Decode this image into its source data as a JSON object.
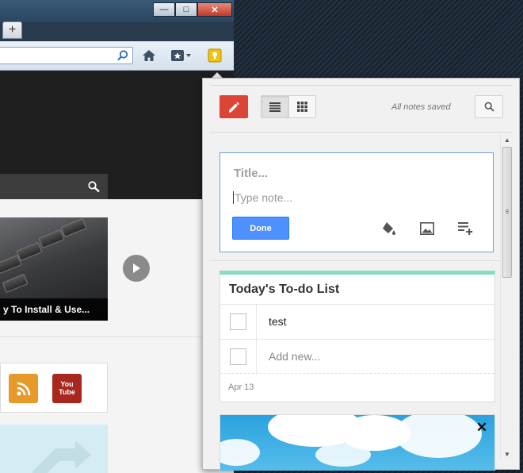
{
  "window": {
    "minimize_glyph": "—",
    "maximize_glyph": "□",
    "close_glyph": "✕",
    "new_tab_label": "+"
  },
  "browser_toolbar": {
    "url_value": "",
    "icons": [
      "search-icon",
      "home-icon",
      "bookmarks-icon",
      "keep-extension-icon"
    ]
  },
  "page": {
    "video_caption": "y To Install & Use...",
    "youtube_logo_text": "You Tube"
  },
  "keep": {
    "logo_icon": "pencil-icon",
    "view_modes": [
      "list-view-icon",
      "grid-view-icon"
    ],
    "status": "All notes saved",
    "composer": {
      "title_placeholder": "Title...",
      "body_placeholder": "Type note...",
      "done_label": "Done",
      "tools": [
        "paint-bucket-icon",
        "image-icon",
        "checklist-add-icon"
      ]
    },
    "todo": {
      "title": "Today's To-do List",
      "accent_color": "#86dcc0",
      "items": [
        {
          "text": "test",
          "checked": false
        }
      ],
      "add_placeholder": "Add new...",
      "date": "Apr 13"
    },
    "image_note": {
      "close_glyph": "✕"
    }
  },
  "colors": {
    "keep_red": "#db4437",
    "done_blue": "#4d90fe",
    "composer_border": "#6d9ed2"
  }
}
